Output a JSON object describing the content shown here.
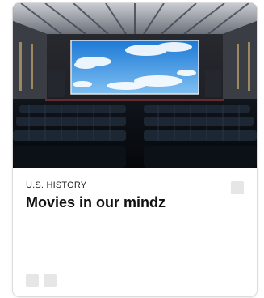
{
  "card": {
    "category": "U.S. HISTORY",
    "title": "Movies in our mindz",
    "hero_alt": "Movie theater auditorium with screen showing blue sky and clouds",
    "actions": [
      "share-icon",
      "more-icon"
    ],
    "bookmark_icon": "bookmark-icon"
  }
}
